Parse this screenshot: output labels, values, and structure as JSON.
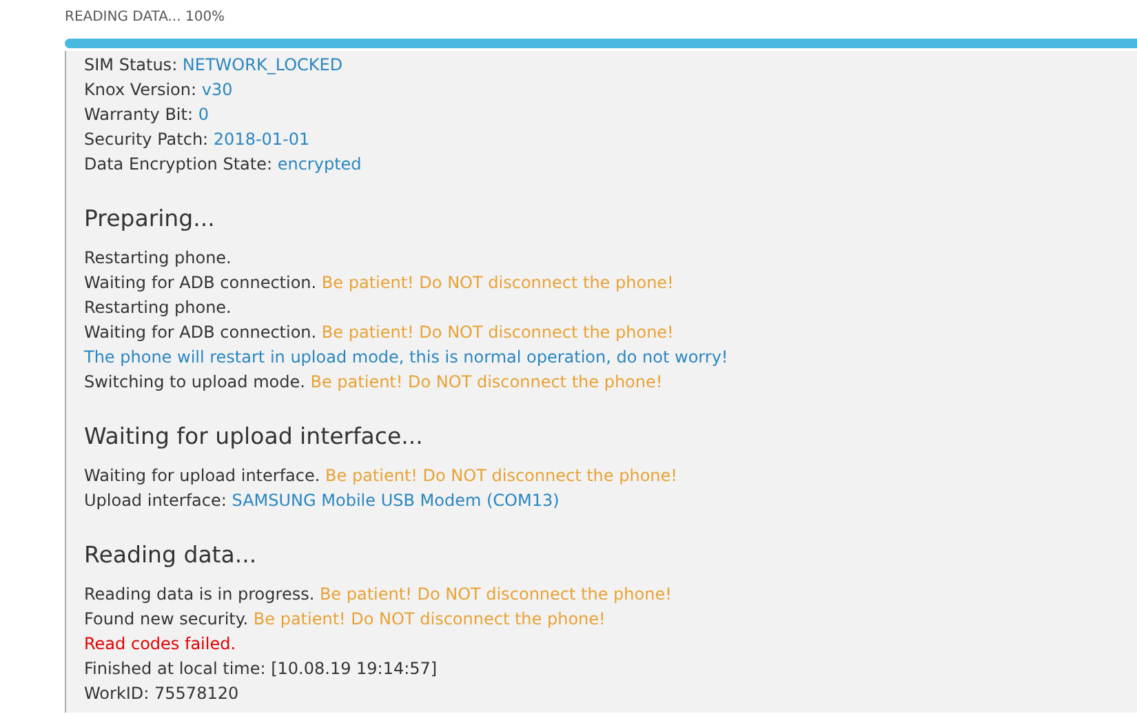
{
  "progress": {
    "label": "READING DATA... 100%",
    "level": 1
  },
  "sections": [
    {
      "lines": [
        [
          {
            "text": "SIM Status: ",
            "kind": "normal"
          },
          {
            "text": "NETWORK_LOCKED",
            "kind": "info"
          }
        ],
        [
          {
            "text": "Knox Version: ",
            "kind": "normal"
          },
          {
            "text": "v30",
            "kind": "info"
          }
        ],
        [
          {
            "text": "Warranty Bit: ",
            "kind": "normal"
          },
          {
            "text": "0",
            "kind": "info"
          }
        ],
        [
          {
            "text": "Security Patch: ",
            "kind": "normal"
          },
          {
            "text": "2018-01-01",
            "kind": "info"
          }
        ],
        [
          {
            "text": "Data Encryption State: ",
            "kind": "normal"
          },
          {
            "text": "encrypted",
            "kind": "info"
          }
        ]
      ]
    },
    {
      "heading": "Preparing...",
      "lines": [
        [
          {
            "text": "Restarting phone.",
            "kind": "normal"
          }
        ],
        [
          {
            "text": "Waiting for ADB connection. ",
            "kind": "normal"
          },
          {
            "text": "Be patient! Do NOT disconnect the phone!",
            "kind": "warning"
          }
        ],
        [
          {
            "text": "Restarting phone.",
            "kind": "normal"
          }
        ],
        [
          {
            "text": "Waiting for ADB connection. ",
            "kind": "normal"
          },
          {
            "text": "Be patient! Do NOT disconnect the phone!",
            "kind": "warning"
          }
        ],
        [
          {
            "text": "The phone will restart in upload mode, this is normal operation, do not worry!",
            "kind": "info"
          }
        ],
        [
          {
            "text": "Switching to upload mode. ",
            "kind": "normal"
          },
          {
            "text": "Be patient! Do NOT disconnect the phone!",
            "kind": "warning"
          }
        ]
      ]
    },
    {
      "heading": "Waiting for upload interface...",
      "lines": [
        [
          {
            "text": "Waiting for upload interface. ",
            "kind": "normal"
          },
          {
            "text": "Be patient! Do NOT disconnect the phone!",
            "kind": "warning"
          }
        ],
        [
          {
            "text": "Upload interface: ",
            "kind": "normal"
          },
          {
            "text": "SAMSUNG Mobile USB Modem (COM13)",
            "kind": "info"
          }
        ]
      ]
    },
    {
      "heading": "Reading data...",
      "lines": [
        [
          {
            "text": "Reading data is in progress. ",
            "kind": "normal"
          },
          {
            "text": "Be patient! Do NOT disconnect the phone!",
            "kind": "warning"
          }
        ],
        [
          {
            "text": "Found new security. ",
            "kind": "normal"
          },
          {
            "text": "Be patient! Do NOT disconnect the phone!",
            "kind": "warning"
          }
        ],
        [
          {
            "text": "Read codes failed.",
            "kind": "error"
          }
        ],
        [
          {
            "text": "Finished at local time: [10.08.19 19:14:57]",
            "kind": "normal"
          }
        ],
        [
          {
            "text": "WorkID: 75578120",
            "kind": "normal"
          }
        ]
      ]
    }
  ]
}
